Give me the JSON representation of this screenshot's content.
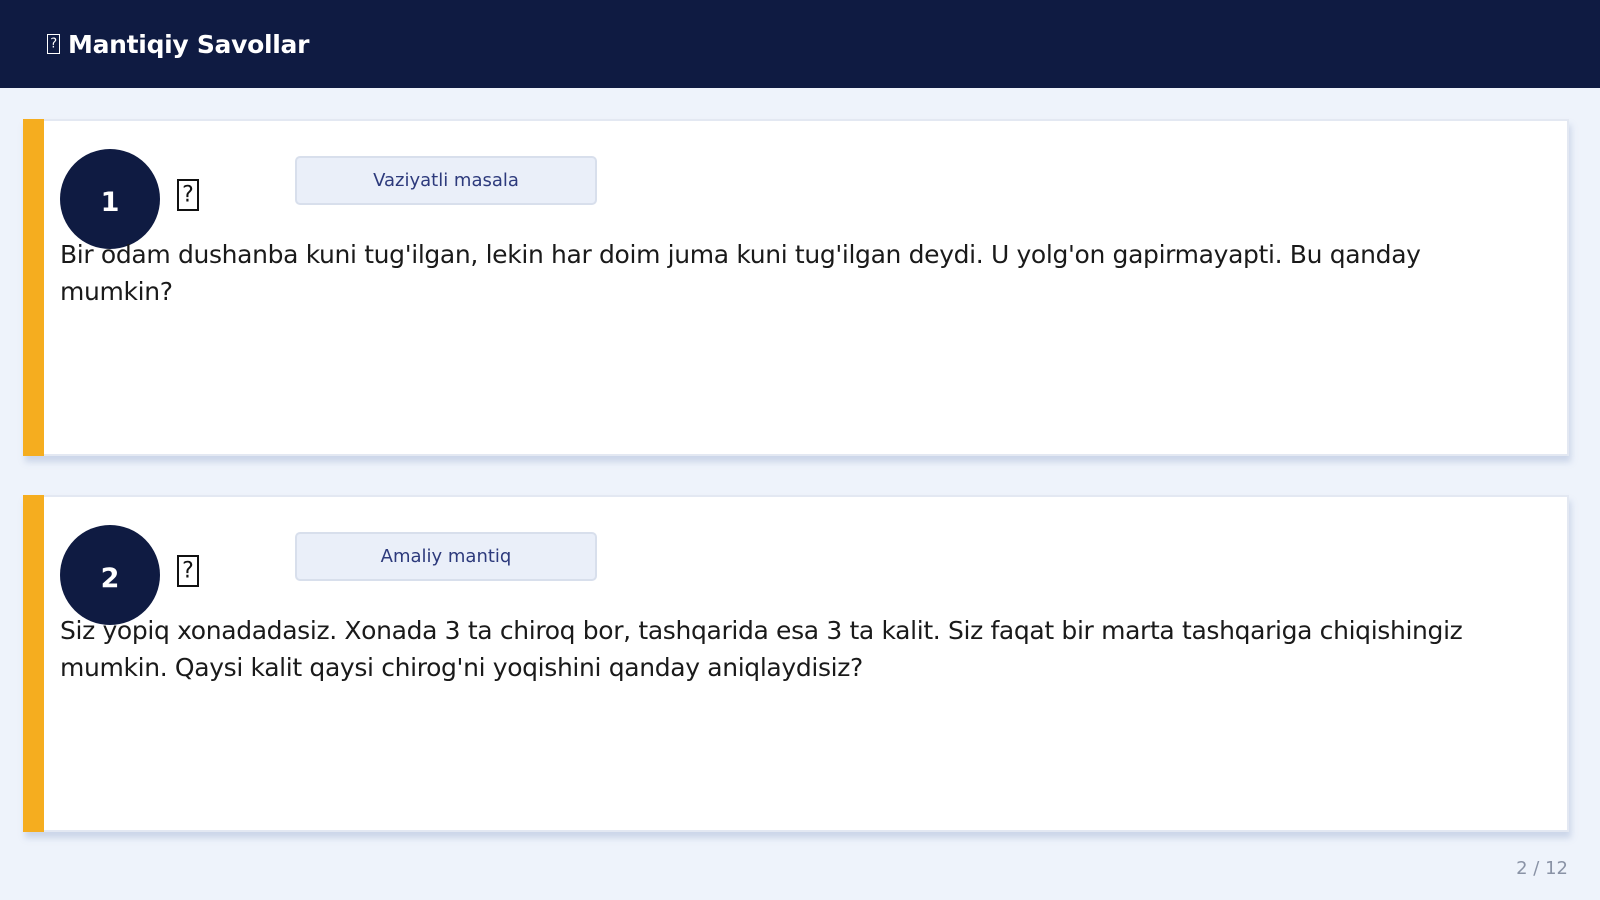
{
  "header": {
    "title": "Mantiqiy Savollar",
    "icon": "missing-glyph-icon"
  },
  "questions": [
    {
      "number": "1",
      "category": "Vaziyatli masala",
      "text": "Bir odam dushanba kuni tug'ilgan, lekin har doim juma kuni tug'ilgan deydi. U yolg'on gapirmayapti. Bu qanday mumkin?"
    },
    {
      "number": "2",
      "category": "Amaliy mantiq",
      "text": "Siz yopiq xonadadasiz. Xonada 3 ta chiroq bor, tashqarida esa 3 ta kalit. Siz faqat bir marta tashqariga chiqishingiz mumkin. Qaysi kalit qaysi chirog'ni yoqishini qanday aniqlaydisiz?"
    }
  ],
  "pagination": {
    "label": "2 / 12"
  },
  "colors": {
    "header_bg": "#0f1b42",
    "accent": "#f5ad1f",
    "page_bg": "#eef3fb",
    "tag_text": "#2d3a7c"
  }
}
